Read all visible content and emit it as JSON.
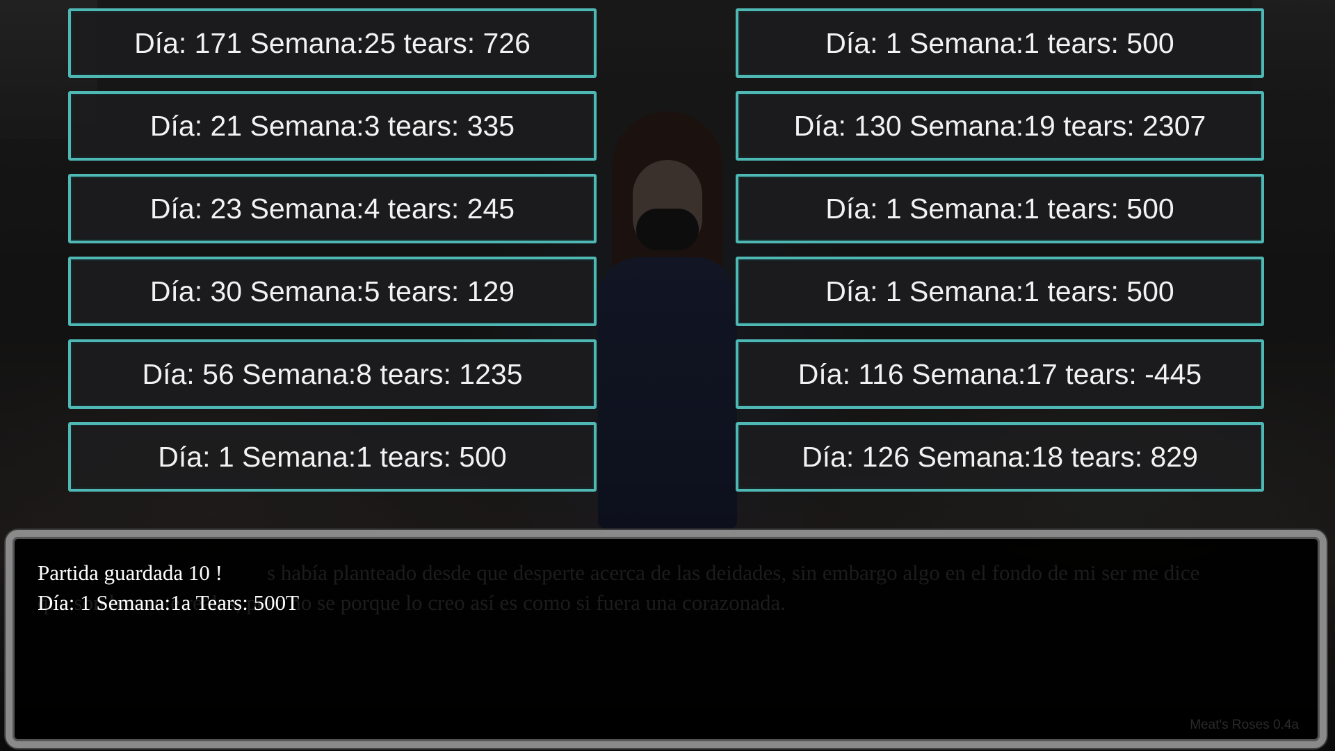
{
  "save_slots": {
    "left": [
      {
        "label": "Día: 171 Semana:25 tears: 726"
      },
      {
        "label": "Día: 21 Semana:3 tears: 335"
      },
      {
        "label": "Día: 23 Semana:4 tears: 245"
      },
      {
        "label": "Día: 30 Semana:5 tears: 129"
      },
      {
        "label": "Día: 56 Semana:8 tears: 1235"
      },
      {
        "label": "Día: 1 Semana:1 tears: 500"
      }
    ],
    "right": [
      {
        "label": "Día: 1 Semana:1 tears: 500"
      },
      {
        "label": "Día: 130 Semana:19 tears: 2307"
      },
      {
        "label": "Día: 1 Semana:1 tears: 500"
      },
      {
        "label": "Día: 1 Semana:1 tears: 500"
      },
      {
        "label": "Día: 116 Semana:17 tears: -445"
      },
      {
        "label": "Día: 126 Semana:18 tears: 829"
      }
    ]
  },
  "message": {
    "line1": "Partida guardada 10 !",
    "line2": "Día: 1 Semana:1a Tears: 500T",
    "ghost_line1": "s había planteado desde que desperte acerca de las deidades, sin embargo algo en el fondo de mi ser me dice",
    "ghost_line2": "que son bastante reales, pero no se porque lo creo así es como si fuera una corazonada."
  },
  "version_label": "Meat's Roses 0.4a",
  "colors": {
    "slot_border": "#4fb8b4",
    "slot_bg": "#1c1c1e",
    "text": "#f2f2f2"
  }
}
